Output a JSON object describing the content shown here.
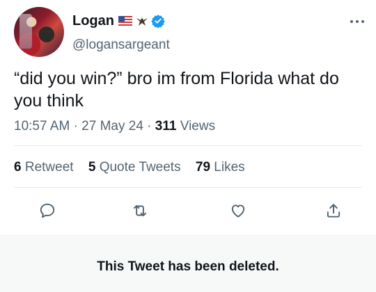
{
  "tweet": {
    "author": {
      "display_name": "Logan",
      "handle": "@logansargeant",
      "badges": [
        "us-flag-icon",
        "eagle-icon",
        "verified-icon"
      ],
      "verified_color": "#1d9bf0"
    },
    "text": "“did you win?” bro im from Florida what do you think",
    "meta": {
      "time": "10:57 AM",
      "date": "27 May 24",
      "views_count": "311",
      "views_label": "Views"
    },
    "stats": {
      "retweets_count": "6",
      "retweets_label": "Retweet",
      "quotes_count": "5",
      "quotes_label": "Quote Tweets",
      "likes_count": "79",
      "likes_label": "Likes"
    },
    "actions": [
      "reply-icon",
      "retweet-icon",
      "like-icon",
      "share-icon"
    ],
    "deleted_notice": "This Tweet has been deleted."
  }
}
